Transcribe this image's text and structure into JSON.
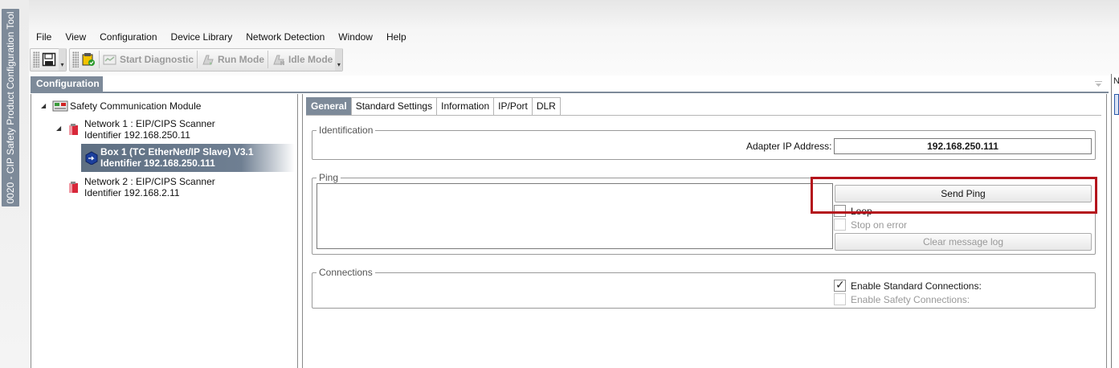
{
  "side_tab": {
    "label": "0020 - CIP Safety Product Configuration Tool"
  },
  "menu": [
    "File",
    "View",
    "Configuration",
    "Device Library",
    "Network Detection",
    "Window",
    "Help"
  ],
  "toolbar": {
    "start_diagnostic": "Start Diagnostic",
    "run_mode": "Run Mode",
    "idle_mode": "Idle Mode"
  },
  "config_panel": {
    "title": "Configuration"
  },
  "tree": {
    "root": "Safety Communication Module",
    "network1": {
      "line1": "Network 1 : EIP/CIPS Scanner",
      "line2": "Identifier 192.168.250.11"
    },
    "box1": {
      "line1": "Box 1 (TC EtherNet/IP Slave) V3.1",
      "line2": "Identifier 192.168.250.111"
    },
    "network2": {
      "line1": "Network 2 : EIP/CIPS Scanner",
      "line2": "Identifier 192.168.2.11"
    }
  },
  "tabs": [
    "General",
    "Standard Settings",
    "Information",
    "IP/Port",
    "DLR"
  ],
  "identification": {
    "legend": "Identification",
    "adapter_ip_label": "Adapter IP Address:",
    "adapter_ip_value": "192.168.250.111"
  },
  "ping": {
    "legend": "Ping",
    "send_ping": "Send Ping",
    "loop": "Loop",
    "stop_on_error": "Stop on error",
    "clear_log": "Clear message log"
  },
  "connections": {
    "legend": "Connections",
    "enable_standard": "Enable Standard Connections:",
    "enable_safety": "Enable Safety Connections:"
  },
  "right_edge": {
    "label": "N"
  },
  "colors": {
    "accent": "#7d8a99",
    "selection": "#5e6f82",
    "highlight": "#b4141c"
  }
}
